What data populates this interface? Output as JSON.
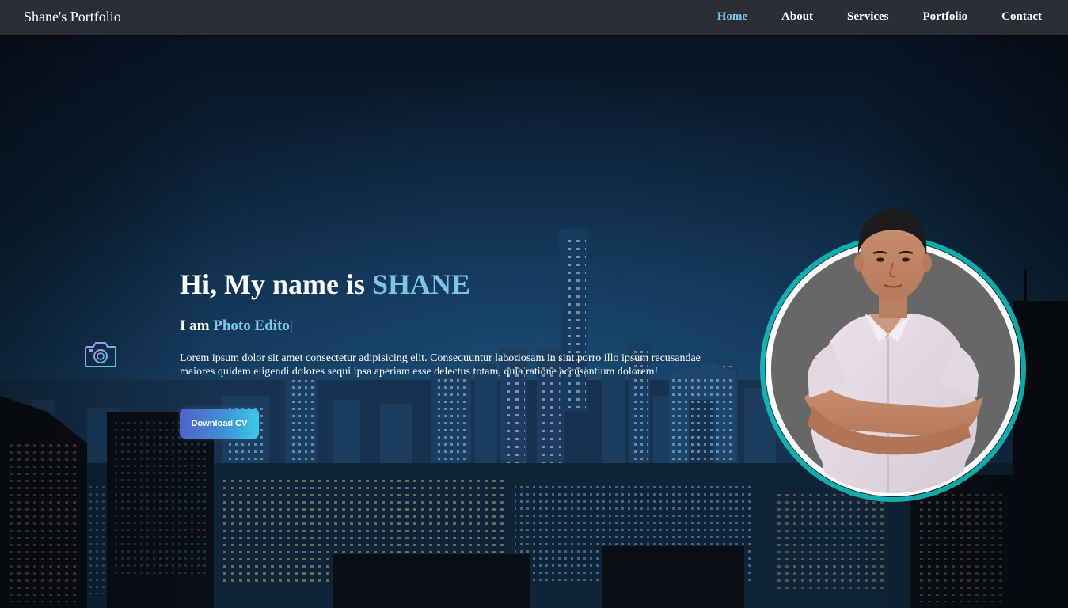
{
  "page": {
    "title": "Shane's Portfolio"
  },
  "nav": {
    "brand": "Shane's Portfolio",
    "items": [
      {
        "label": "Home",
        "active": true
      },
      {
        "label": "About",
        "active": false
      },
      {
        "label": "Services",
        "active": false
      },
      {
        "label": "Portfolio",
        "active": false
      },
      {
        "label": "Contact",
        "active": false
      }
    ]
  },
  "hero": {
    "greeting": "Hi, My name is ",
    "name": "SHANE",
    "role_prefix": "I am ",
    "role_typed": "Photo Edito",
    "cursor": "|",
    "description": "Lorem ipsum dolor sit amet consectetur adipisicing elit. Consequuntur laboriosam in sint porro illo ipsum recusandae maiores quidem eligendi dolores sequi ipsa aperiam esse delectus totam, quia ratione accusantium dolorem!",
    "cta_label": "Download CV"
  },
  "icons": {
    "camera": "camera-icon"
  },
  "colors": {
    "accent": "#7dc6ea",
    "navbar": "#2b2f35",
    "button_gradient_start": "#5361c7",
    "button_gradient_end": "#3fc8e8",
    "profile_ring": "#ffffff",
    "profile_glow": "#13c5c0"
  }
}
